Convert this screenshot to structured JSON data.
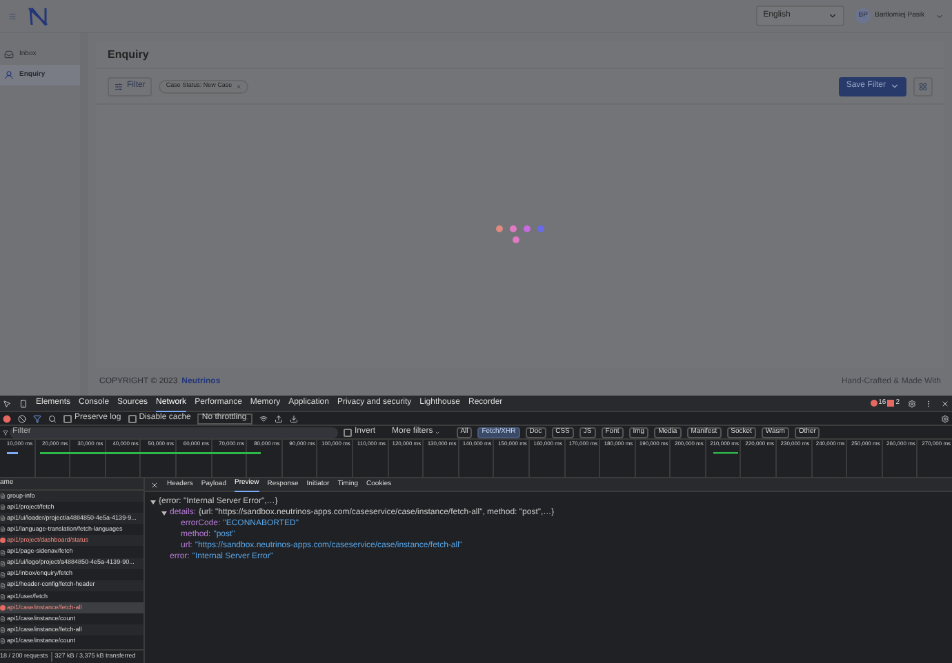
{
  "header": {
    "language": "English",
    "avatar": "BP",
    "user": "Bartłomiej Pasik"
  },
  "sidebar": {
    "items": [
      {
        "label": "Inbox",
        "selected": false
      },
      {
        "label": "Enquiry",
        "selected": true
      }
    ]
  },
  "page": {
    "title": "Enquiry",
    "filter_button": "Filter",
    "chips": [
      "Case Status: New Case"
    ],
    "save_filter": "Save Filter"
  },
  "footer": {
    "copyright": "COPYRIGHT © 2023",
    "brand": "Neutrinos",
    "right": "Hand-Crafted & Made With"
  },
  "devtools": {
    "tabs": [
      {
        "label": "Elements",
        "selected": false
      },
      {
        "label": "Console",
        "selected": false
      },
      {
        "label": "Sources",
        "selected": false
      },
      {
        "label": "Network",
        "selected": true
      },
      {
        "label": "Performance",
        "selected": false
      },
      {
        "label": "Memory",
        "selected": false
      },
      {
        "label": "Application",
        "selected": false
      },
      {
        "label": "Privacy and security",
        "selected": false
      },
      {
        "label": "Lighthouse",
        "selected": false
      },
      {
        "label": "Recorder",
        "selected": false
      }
    ],
    "errors": "16",
    "warnings": "2",
    "toolbar": {
      "preserve_log": {
        "label": "Preserve log",
        "checked": false
      },
      "disable_cache": {
        "label": "Disable cache",
        "checked": false
      },
      "throttling": "No throttling"
    },
    "filter": {
      "placeholder": "Filter",
      "invert": {
        "label": "Invert",
        "checked": false
      },
      "more_filters": "More filters",
      "types": [
        {
          "label": "All",
          "selected": false
        },
        {
          "label": "Fetch/XHR",
          "selected": true
        },
        {
          "label": "Doc",
          "selected": false
        },
        {
          "label": "CSS",
          "selected": false
        },
        {
          "label": "JS",
          "selected": false
        },
        {
          "label": "Font",
          "selected": false
        },
        {
          "label": "Img",
          "selected": false
        },
        {
          "label": "Media",
          "selected": false
        },
        {
          "label": "Manifest",
          "selected": false
        },
        {
          "label": "Socket",
          "selected": false
        },
        {
          "label": "Wasm",
          "selected": false
        },
        {
          "label": "Other",
          "selected": false
        }
      ]
    },
    "timeline_ticks": [
      "10,000 ms",
      "20,000 ms",
      "30,000 ms",
      "40,000 ms",
      "50,000 ms",
      "60,000 ms",
      "70,000 ms",
      "80,000 ms",
      "90,000 ms",
      "100,000 ms",
      "110,000 ms",
      "120,000 ms",
      "130,000 ms",
      "140,000 ms",
      "150,000 ms",
      "160,000 ms",
      "170,000 ms",
      "180,000 ms",
      "190,000 ms",
      "200,000 ms",
      "210,000 ms",
      "220,000 ms",
      "230,000 ms",
      "240,000 ms",
      "250,000 ms",
      "260,000 ms",
      "270,000 ms"
    ],
    "list_header": "ame",
    "requests": [
      {
        "name": "group-info",
        "error": false,
        "selected": false
      },
      {
        "name": "api1/project/fetch",
        "error": false,
        "selected": false
      },
      {
        "name": "api1/ui/loader/project/a4884850-4e5a-4139-9...",
        "error": false,
        "selected": false
      },
      {
        "name": "api1/language-translation/fetch-languages",
        "error": false,
        "selected": false
      },
      {
        "name": "api1/project/dashboard/status",
        "error": true,
        "selected": false
      },
      {
        "name": "api1/page-sidenav/fetch",
        "error": false,
        "selected": false
      },
      {
        "name": "api1/ui/logo/project/a4884850-4e5a-4139-90...",
        "error": false,
        "selected": false
      },
      {
        "name": "api1/inbox/enquiry/fetch",
        "error": false,
        "selected": false
      },
      {
        "name": "api1/header-config/fetch-header",
        "error": false,
        "selected": false
      },
      {
        "name": "api1/user/fetch",
        "error": false,
        "selected": false
      },
      {
        "name": "api1/case/instance/fetch-all",
        "error": true,
        "selected": true
      },
      {
        "name": "api1/case/instance/count",
        "error": false,
        "selected": false
      },
      {
        "name": "api1/case/instance/fetch-all",
        "error": false,
        "selected": false
      },
      {
        "name": "api1/case/instance/count",
        "error": false,
        "selected": false
      }
    ],
    "status": {
      "requests": "18 / 200 requests",
      "transferred": "327 kB / 3,375 kB transferred"
    },
    "detail_tabs": [
      {
        "label": "Headers",
        "selected": false
      },
      {
        "label": "Payload",
        "selected": false
      },
      {
        "label": "Preview",
        "selected": true
      },
      {
        "label": "Response",
        "selected": false
      },
      {
        "label": "Initiator",
        "selected": false
      },
      {
        "label": "Timing",
        "selected": false
      },
      {
        "label": "Cookies",
        "selected": false
      }
    ],
    "preview": {
      "summary": "{error: \"Internal Server Error\",…}",
      "expanded": true,
      "children": [
        {
          "key": "details:",
          "summary": "{url: \"https://sandbox.neutrinos-apps.com/caseservice/case/instance/fetch-all\", method: \"post\",…}",
          "expanded": true,
          "children": [
            {
              "key": "errorCode:",
              "value": "\"ECONNABORTED\""
            },
            {
              "key": "method:",
              "value": "\"post\""
            },
            {
              "key": "url:",
              "value": "\"https://sandbox.neutrinos-apps.com/caseservice/case/instance/fetch-all\""
            }
          ]
        },
        {
          "key": "error:",
          "value": "\"Internal Server Error\""
        }
      ]
    }
  }
}
